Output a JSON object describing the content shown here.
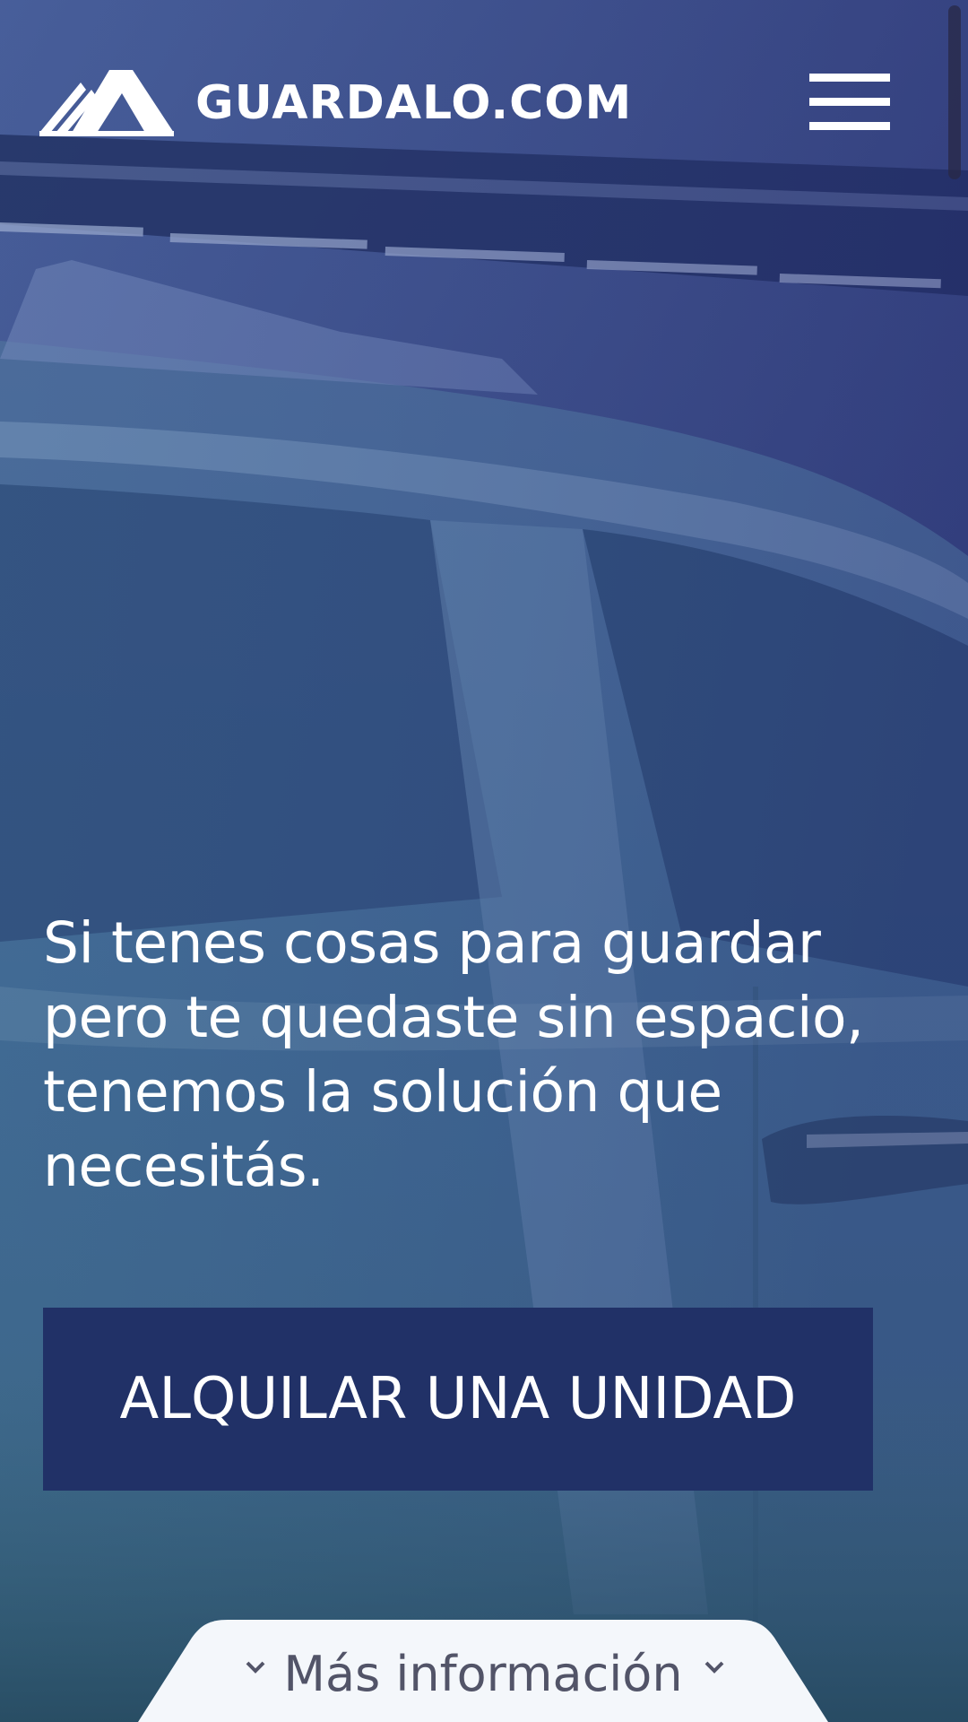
{
  "header": {
    "logo_text": "GUARDALO.COM",
    "logo_icon": "mountain-logo-icon",
    "menu_icon": "hamburger-menu-icon"
  },
  "hero": {
    "headline": "Si tenes cosas para guardar pero te quedaste sin espacio, tenemos la solución que necesitás.",
    "cta_label": "ALQUILAR UNA UNIDAD"
  },
  "more_info": {
    "label": "Más información",
    "icon": "chevron-down-icon"
  },
  "colors": {
    "cta_background": "#213167",
    "overlay_top": "#5a5f9e",
    "overlay_bottom": "#3f6f87",
    "text": "#ffffff",
    "tab_background": "#f4f7fb",
    "tab_text": "#525468"
  }
}
